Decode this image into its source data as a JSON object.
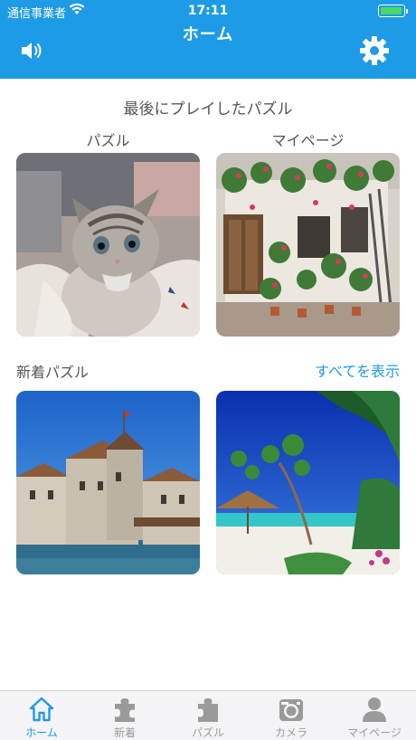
{
  "status_bar": {
    "carrier": "通信事業者",
    "time": "17:11",
    "battery_level": 1.0
  },
  "header": {
    "title": "ホーム",
    "left_icon": "speaker-icon",
    "right_icon": "gear-icon"
  },
  "recent": {
    "title": "最後にプレイしたパズル",
    "puzzle_label": "パズル",
    "mypage_label": "マイページ",
    "puzzle_image": "kitten-photo",
    "mypage_image": "flower-patio-photo"
  },
  "new_puzzles": {
    "title": "新着パズル",
    "show_all": "すべてを表示",
    "images": [
      "lakeside-castle-photo",
      "tropical-beach-photo"
    ]
  },
  "tabbar": {
    "tabs": [
      {
        "label": "ホーム",
        "icon": "home-icon",
        "active": true
      },
      {
        "label": "新着",
        "icon": "puzzle-piece-icon",
        "active": false
      },
      {
        "label": "パズル",
        "icon": "puzzle-piece-icon",
        "active": false
      },
      {
        "label": "カメラ",
        "icon": "camera-icon",
        "active": false
      },
      {
        "label": "マイページ",
        "icon": "person-icon",
        "active": false
      }
    ]
  },
  "colors": {
    "accent": "#1e9be6",
    "tab_inactive": "#9a9a9a",
    "text": "#555555"
  }
}
